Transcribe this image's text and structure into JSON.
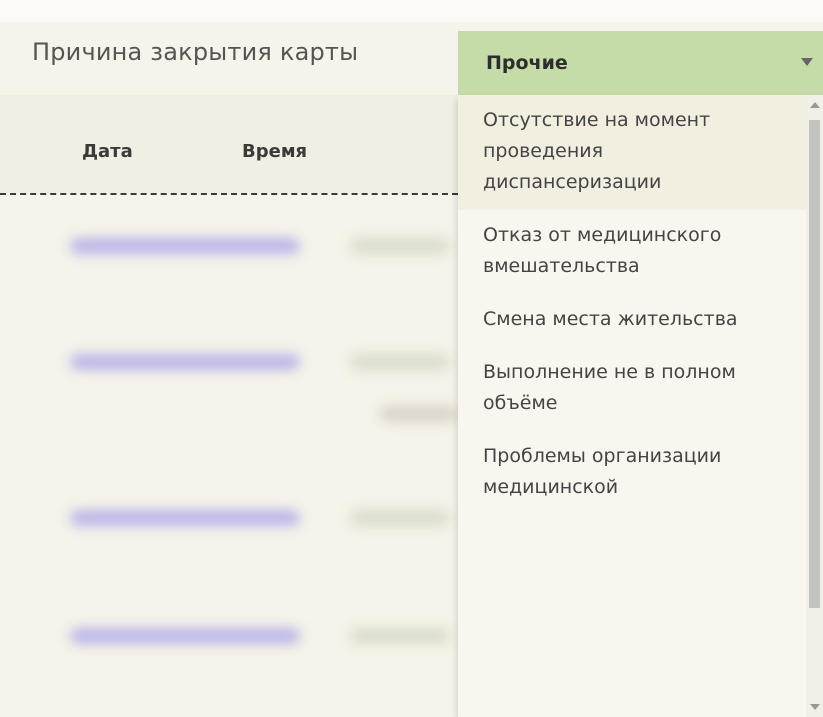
{
  "field": {
    "label": "Причина закрытия карты",
    "selected_value": "Прочие"
  },
  "table": {
    "columns": [
      "Дата",
      "Время"
    ]
  },
  "dropdown": {
    "options": [
      "Отсутствие на момент проведения диспансеризации",
      "Отказ от медицинского вмешательства",
      "Смена места жительства",
      "Выполнение не в полном объёме",
      "Проблемы организации медицинской"
    ]
  },
  "colors": {
    "select_bg": "#c5dba8",
    "page_bg": "#f6f3ea",
    "dropdown_bg": "#f8f6ef"
  }
}
